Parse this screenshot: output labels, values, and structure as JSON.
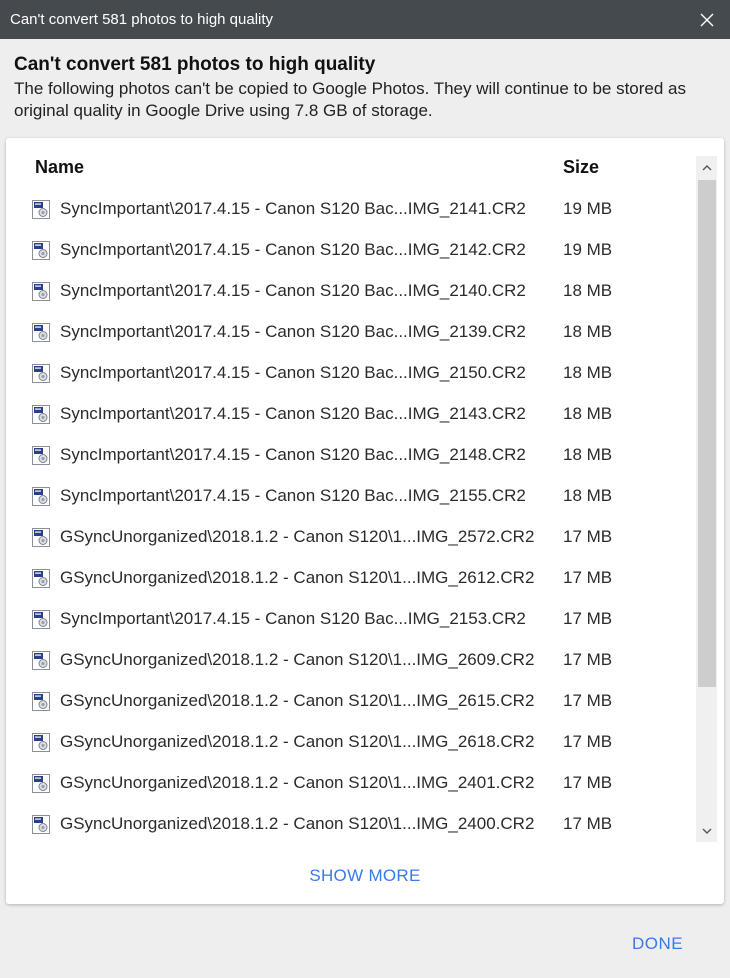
{
  "window": {
    "title": "Can't convert 581 photos to high quality"
  },
  "dialog": {
    "heading": "Can't convert 581 photos to high quality",
    "description": "The following photos can't be copied to Google Photos. They will continue to be stored as original quality in Google Drive using 7.8 GB of storage."
  },
  "table": {
    "headers": {
      "name": "Name",
      "size": "Size"
    },
    "rows": [
      {
        "name": "SyncImportant\\2017.4.15 - Canon S120 Bac...IMG_2141.CR2",
        "size": "19 MB"
      },
      {
        "name": "SyncImportant\\2017.4.15 - Canon S120 Bac...IMG_2142.CR2",
        "size": "19 MB"
      },
      {
        "name": "SyncImportant\\2017.4.15 - Canon S120 Bac...IMG_2140.CR2",
        "size": "18 MB"
      },
      {
        "name": "SyncImportant\\2017.4.15 - Canon S120 Bac...IMG_2139.CR2",
        "size": "18 MB"
      },
      {
        "name": "SyncImportant\\2017.4.15 - Canon S120 Bac...IMG_2150.CR2",
        "size": "18 MB"
      },
      {
        "name": "SyncImportant\\2017.4.15 - Canon S120 Bac...IMG_2143.CR2",
        "size": "18 MB"
      },
      {
        "name": "SyncImportant\\2017.4.15 - Canon S120 Bac...IMG_2148.CR2",
        "size": "18 MB"
      },
      {
        "name": "SyncImportant\\2017.4.15 - Canon S120 Bac...IMG_2155.CR2",
        "size": "18 MB"
      },
      {
        "name": "GSyncUnorganized\\2018.1.2 - Canon S120\\1...IMG_2572.CR2",
        "size": "17 MB"
      },
      {
        "name": "GSyncUnorganized\\2018.1.2 - Canon S120\\1...IMG_2612.CR2",
        "size": "17 MB"
      },
      {
        "name": "SyncImportant\\2017.4.15 - Canon S120 Bac...IMG_2153.CR2",
        "size": "17 MB"
      },
      {
        "name": "GSyncUnorganized\\2018.1.2 - Canon S120\\1...IMG_2609.CR2",
        "size": "17 MB"
      },
      {
        "name": "GSyncUnorganized\\2018.1.2 - Canon S120\\1...IMG_2615.CR2",
        "size": "17 MB"
      },
      {
        "name": "GSyncUnorganized\\2018.1.2 - Canon S120\\1...IMG_2618.CR2",
        "size": "17 MB"
      },
      {
        "name": "GSyncUnorganized\\2018.1.2 - Canon S120\\1...IMG_2401.CR2",
        "size": "17 MB"
      },
      {
        "name": "GSyncUnorganized\\2018.1.2 - Canon S120\\1...IMG_2400.CR2",
        "size": "17 MB"
      }
    ],
    "row_icon": "raw-image-file-icon"
  },
  "actions": {
    "show_more": "SHOW MORE",
    "done": "DONE"
  },
  "icons": {
    "close": "close-icon",
    "scroll_up": "chevron-up-icon",
    "scroll_down": "chevron-down-icon"
  },
  "colors": {
    "titlebar": "#454a4f",
    "background": "#eeeeee",
    "accent": "#3b78e7"
  }
}
